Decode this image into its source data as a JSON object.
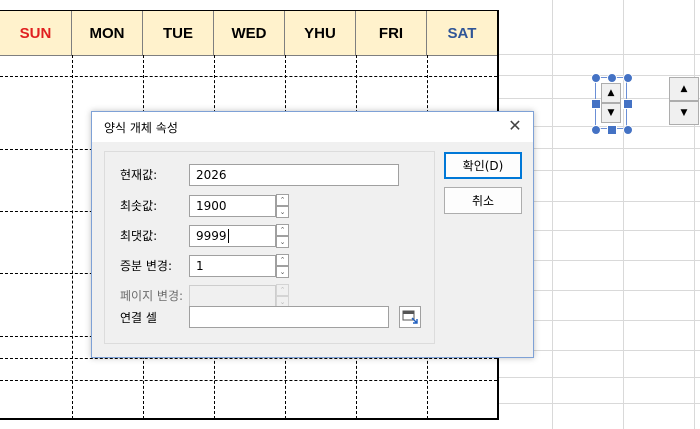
{
  "calendar": {
    "days": [
      {
        "label": "SUN",
        "color": "#e02020"
      },
      {
        "label": "MON",
        "color": "#000000"
      },
      {
        "label": "TUE",
        "color": "#000000"
      },
      {
        "label": "WED",
        "color": "#000000"
      },
      {
        "label": "YHU",
        "color": "#000000"
      },
      {
        "label": "FRI",
        "color": "#000000"
      },
      {
        "label": "SAT",
        "color": "#2f5597"
      }
    ],
    "header_bg": "#fff2cc"
  },
  "dialog": {
    "title": "양식 개체 속성",
    "close_icon": "close-icon",
    "fields": {
      "current_value": {
        "label": "현재값:",
        "value": "2026"
      },
      "min_value": {
        "label": "최솟값:",
        "value": "1900"
      },
      "max_value": {
        "label": "최댓값:",
        "value": "9999"
      },
      "increment": {
        "label": "증분 변경:",
        "value": "1"
      },
      "page_change": {
        "label": "페이지 변경:",
        "value": ""
      },
      "cell_link": {
        "label": "연결 셀",
        "value": ""
      }
    },
    "buttons": {
      "ok": "확인(D)",
      "cancel": "취소"
    }
  },
  "colors": {
    "accent": "#0078d7",
    "selection": "#4472c4"
  }
}
